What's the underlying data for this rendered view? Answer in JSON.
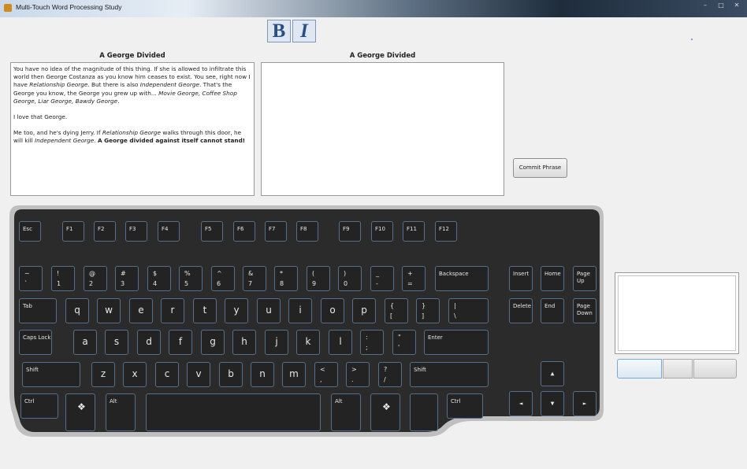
{
  "window": {
    "title": "Multi-Touch Word Processing Study"
  },
  "toolbar": {
    "bold_label": "B",
    "italic_label": "I"
  },
  "source_pane": {
    "heading": "A George Divided",
    "paragraphs": [
      [
        {
          "t": "You have no idea of the magnitude of this thing. If she is allowed to infiltrate this world then George Costanza as you know him ceases to exist. You see, right now I have "
        },
        {
          "t": "Relationship George",
          "s": "i"
        },
        {
          "t": ". But there is also "
        },
        {
          "t": "Independent George",
          "s": "i"
        },
        {
          "t": ". That's the George you know, the George you grew up with... "
        },
        {
          "t": "Movie George, Coffee Shop George, Liar George, Bawdy George",
          "s": "i"
        },
        {
          "t": "."
        }
      ],
      [
        {
          "t": "I love that George."
        }
      ],
      [
        {
          "t": "Me too, and he's dying Jerry. If "
        },
        {
          "t": "Relationship George",
          "s": "i"
        },
        {
          "t": " walks through this door, he will kill "
        },
        {
          "t": "Independent George",
          "s": "i"
        },
        {
          "t": ". "
        },
        {
          "t": "A George divided against itself cannot stand!",
          "s": "b"
        }
      ]
    ]
  },
  "target_pane": {
    "heading": "A George Divided",
    "text": ""
  },
  "commit_button": {
    "label": "Commit Phrase"
  },
  "keyboard": {
    "frame_color": "#bfbfbf",
    "body_color": "#2b2b2b",
    "key_border_color": "#56708c",
    "keys": [
      {
        "id": "esc",
        "label": "Esc"
      },
      {
        "id": "f1",
        "label": "F1"
      },
      {
        "id": "f2",
        "label": "F2"
      },
      {
        "id": "f3",
        "label": "F3"
      },
      {
        "id": "f4",
        "label": "F4"
      },
      {
        "id": "f5",
        "label": "F5"
      },
      {
        "id": "f6",
        "label": "F6"
      },
      {
        "id": "f7",
        "label": "F7"
      },
      {
        "id": "f8",
        "label": "F8"
      },
      {
        "id": "f9",
        "label": "F9"
      },
      {
        "id": "f10",
        "label": "F10"
      },
      {
        "id": "f11",
        "label": "F11"
      },
      {
        "id": "f12",
        "label": "F12"
      },
      {
        "id": "backtick",
        "upper": "~",
        "lower": "`"
      },
      {
        "id": "1",
        "upper": "!",
        "lower": "1"
      },
      {
        "id": "2",
        "upper": "@",
        "lower": "2"
      },
      {
        "id": "3",
        "upper": "#",
        "lower": "3"
      },
      {
        "id": "4",
        "upper": "$",
        "lower": "4"
      },
      {
        "id": "5",
        "upper": "%",
        "lower": "5"
      },
      {
        "id": "6",
        "upper": "^",
        "lower": "6"
      },
      {
        "id": "7",
        "upper": "&",
        "lower": "7"
      },
      {
        "id": "8",
        "upper": "*",
        "lower": "8"
      },
      {
        "id": "9",
        "upper": "(",
        "lower": "9"
      },
      {
        "id": "0",
        "upper": ")",
        "lower": "0"
      },
      {
        "id": "minus",
        "upper": "_",
        "lower": "-"
      },
      {
        "id": "equals",
        "upper": "+",
        "lower": "="
      },
      {
        "id": "backspace",
        "label": "Backspace"
      },
      {
        "id": "tab",
        "label": "Tab"
      },
      {
        "id": "q",
        "label": "q"
      },
      {
        "id": "w",
        "label": "w"
      },
      {
        "id": "e",
        "label": "e"
      },
      {
        "id": "r",
        "label": "r"
      },
      {
        "id": "t",
        "label": "t"
      },
      {
        "id": "y",
        "label": "y"
      },
      {
        "id": "u",
        "label": "u"
      },
      {
        "id": "i",
        "label": "i"
      },
      {
        "id": "o",
        "label": "o"
      },
      {
        "id": "p",
        "label": "p"
      },
      {
        "id": "lbracket",
        "upper": "{",
        "lower": "["
      },
      {
        "id": "rbracket",
        "upper": "}",
        "lower": "]"
      },
      {
        "id": "backslash",
        "upper": "|",
        "lower": "\\"
      },
      {
        "id": "capslock",
        "label": "Caps Lock"
      },
      {
        "id": "a",
        "label": "a"
      },
      {
        "id": "s",
        "label": "s"
      },
      {
        "id": "d",
        "label": "d"
      },
      {
        "id": "f",
        "label": "f"
      },
      {
        "id": "g",
        "label": "g"
      },
      {
        "id": "h",
        "label": "h"
      },
      {
        "id": "j",
        "label": "j"
      },
      {
        "id": "k",
        "label": "k"
      },
      {
        "id": "l",
        "label": "l"
      },
      {
        "id": "semicolon",
        "upper": ":",
        "lower": ";"
      },
      {
        "id": "quote",
        "upper": "\"",
        "lower": "'"
      },
      {
        "id": "enter",
        "label": "Enter"
      },
      {
        "id": "lshift",
        "label": "Shift"
      },
      {
        "id": "z",
        "label": "z"
      },
      {
        "id": "x",
        "label": "x"
      },
      {
        "id": "c",
        "label": "c"
      },
      {
        "id": "v",
        "label": "v"
      },
      {
        "id": "b",
        "label": "b"
      },
      {
        "id": "n",
        "label": "n"
      },
      {
        "id": "m",
        "label": "m"
      },
      {
        "id": "comma",
        "upper": "<",
        "lower": ","
      },
      {
        "id": "period",
        "upper": ">",
        "lower": "."
      },
      {
        "id": "slash",
        "upper": "?",
        "lower": "/"
      },
      {
        "id": "rshift",
        "label": "Shift"
      },
      {
        "id": "lctrl",
        "label": "Ctrl"
      },
      {
        "id": "lwin",
        "icon": "windows-logo"
      },
      {
        "id": "lalt",
        "label": "Alt"
      },
      {
        "id": "space",
        "label": ""
      },
      {
        "id": "ralt",
        "label": "Alt"
      },
      {
        "id": "rwin",
        "icon": "windows-logo"
      },
      {
        "id": "menu",
        "label": ""
      },
      {
        "id": "rctrl",
        "label": "Ctrl"
      },
      {
        "id": "insert",
        "label": "Insert"
      },
      {
        "id": "home",
        "label": "Home"
      },
      {
        "id": "pageup",
        "label": "Page\nUp"
      },
      {
        "id": "delete",
        "label": "Delete"
      },
      {
        "id": "end",
        "label": "End"
      },
      {
        "id": "pagedown",
        "label": "Page\nDown"
      },
      {
        "id": "up",
        "icon": "arrow-up"
      },
      {
        "id": "left",
        "icon": "arrow-left"
      },
      {
        "id": "down",
        "icon": "arrow-down"
      },
      {
        "id": "right",
        "icon": "arrow-right"
      }
    ]
  },
  "touchpad": {
    "buttons": [
      "left",
      "middle",
      "right"
    ]
  }
}
